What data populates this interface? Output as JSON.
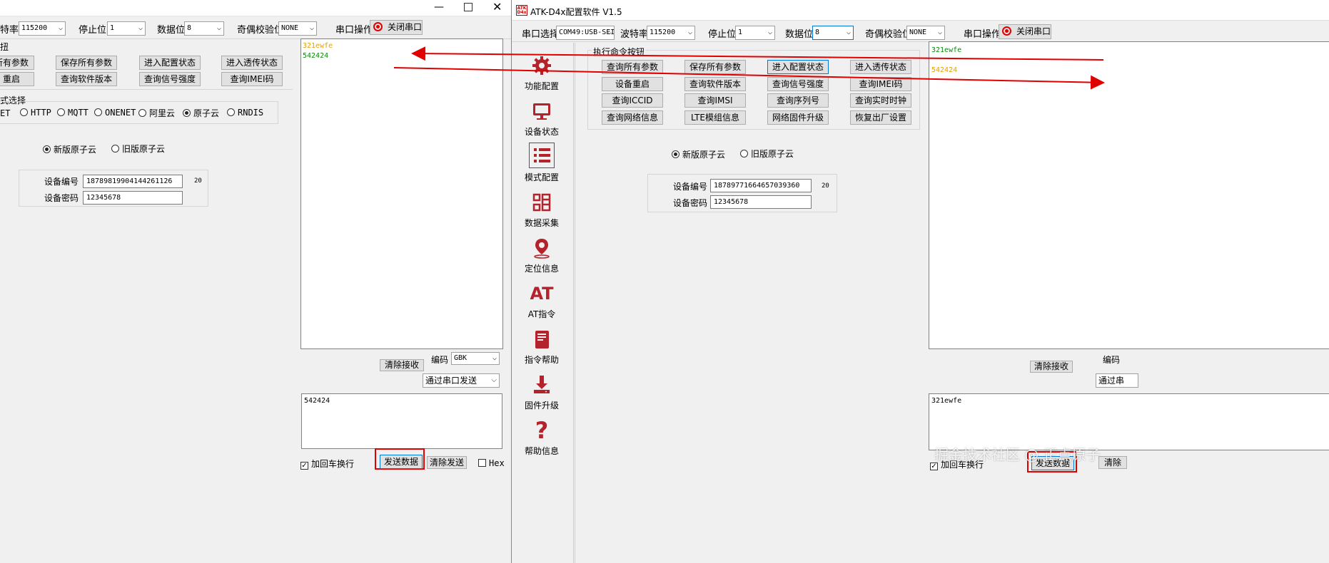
{
  "left": {
    "baud_label": "特率",
    "baud_value": "115200",
    "stop_label": "停止位",
    "stop_value": "1",
    "data_label": "数据位",
    "data_value": "8",
    "parity_label": "奇偶校验位",
    "parity_value": "NONE",
    "serial_op_label": "串口操作",
    "close_port": "关闭串口",
    "cmd_group_title": "扭",
    "buttons": [
      "所有参数",
      "保存所有参数",
      "进入配置状态",
      "进入透传状态",
      "重启",
      "查询软件版本",
      "查询信号强度",
      "查询IMEI码"
    ],
    "mode_group_title": "式选择",
    "modes": [
      "ET",
      "HTTP",
      "MQTT",
      "ONENET",
      "阿里云",
      "原子云",
      "RNDIS"
    ],
    "cloud_new": "新版原子云",
    "cloud_old": "旧版原子云",
    "dev_id_label": "设备编号",
    "dev_id_value": "18789819904144261126",
    "dev_id_len": "20",
    "dev_pwd_label": "设备密码",
    "dev_pwd_value": "12345678",
    "recv_lines": [
      "321ewfe",
      "542424"
    ],
    "clear_recv": "清除接收",
    "encoding_label": "编码",
    "encoding_value": "GBK",
    "send_via": "通过串口发送",
    "send_text": "542424",
    "crlf": "加回车换行",
    "send_btn": "发送数据",
    "clear_send": "清除发送",
    "hex": "Hex"
  },
  "right": {
    "title": "ATK-D4x配置软件 V1.5",
    "logo_top": "ATK",
    "logo_bottom": "D4x",
    "port_label": "串口选择",
    "port_value": "COM49:USB-SEI",
    "baud_label": "波特率",
    "baud_value": "115200",
    "stop_label": "停止位",
    "stop_value": "1",
    "data_label": "数据位",
    "data_value": "8",
    "parity_label": "奇偶校验位",
    "parity_value": "NONE",
    "serial_op_label": "串口操作",
    "close_port": "关闭串口",
    "sidebar": [
      "功能配置",
      "设备状态",
      "模式配置",
      "数据采集",
      "定位信息",
      "AT指令",
      "指令帮助",
      "固件升级",
      "帮助信息"
    ],
    "at_glyph": "AT",
    "help_glyph": "?",
    "cmd_group_title": "执行命令按钮",
    "buttons": [
      "查询所有参数",
      "保存所有参数",
      "进入配置状态",
      "进入透传状态",
      "设备重启",
      "查询软件版本",
      "查询信号强度",
      "查询IMEI码",
      "查询ICCID",
      "查询IMSI",
      "查询序列号",
      "查询实时时钟",
      "查询网络信息",
      "LTE模组信息",
      "网络固件升级",
      "恢复出厂设置"
    ],
    "cloud_new": "新版原子云",
    "cloud_old": "旧版原子云",
    "dev_id_label": "设备编号",
    "dev_id_value": "18789771664657039360",
    "dev_id_len": "20",
    "dev_pwd_label": "设备密码",
    "dev_pwd_value": "12345678",
    "recv_lines": [
      "321ewfe",
      "542424"
    ],
    "clear_recv": "清除接收",
    "encoding_label": "编码",
    "send_via": "通过串",
    "send_text": "321ewfe",
    "crlf": "加回车换行",
    "send_btn": "发送数据",
    "clear_send": "清除",
    "watermark": "掘金技术社区 @ 正点原子"
  },
  "colors": {
    "accent_red": "#e00000",
    "recv_green": "#0a8a0a",
    "recv_orange": "#e6a000",
    "focus_blue": "#0078d7"
  },
  "icons": [
    "minimize-icon",
    "maximize-icon",
    "close-icon",
    "record-icon",
    "gear-icon",
    "monitor-icon",
    "list-icon",
    "data-collect-icon",
    "location-pin-icon",
    "at-icon",
    "book-icon",
    "download-icon",
    "question-icon"
  ]
}
